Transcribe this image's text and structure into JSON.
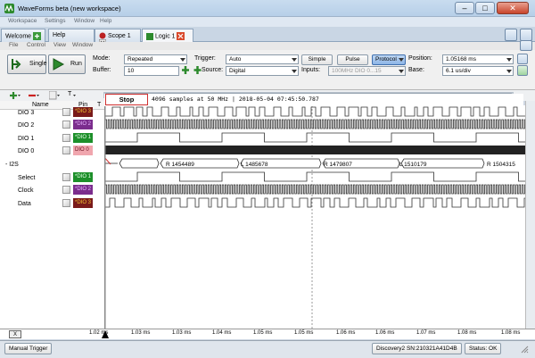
{
  "window": {
    "title": "WaveForms beta (new workspace)",
    "controls": {
      "minimize": "–",
      "maximize": "□",
      "close": "✕"
    }
  },
  "menu": [
    "Workspace",
    "Settings",
    "Window",
    "Help"
  ],
  "tabs": [
    {
      "label": "Welcome",
      "active": false
    },
    {
      "label": "Help",
      "active": false
    },
    {
      "label": "Scope 1",
      "active": false
    },
    {
      "label": "Logic 1",
      "active": true
    }
  ],
  "submenu": [
    "File",
    "Control",
    "View",
    "Window"
  ],
  "controls": {
    "single_label": "Single",
    "run_label": "Run",
    "mode_label": "Mode:",
    "mode_value": "Repeated",
    "buffer_label": "Buffer:",
    "buffer_value": "10",
    "trigger_label": "Trigger:",
    "trigger_value": "Auto",
    "source_label": "Source:",
    "source_value": "Digital",
    "simple_label": "Simple",
    "pulse_label": "Pulse",
    "protocol_label": "Protocol",
    "inputs_label": "Inputs:",
    "inputs_value": "100MHz DIO 0...15",
    "position_label": "Position:",
    "position_value": "1.05168 ms",
    "base_label": "Base:",
    "base_value": "6.1 us/div"
  },
  "toolbar": {
    "add": "+",
    "remove": "−",
    "t_label": "T"
  },
  "channel_header": {
    "name": "Name",
    "pin": "Pin",
    "t": "T"
  },
  "status": {
    "stop_label": "Stop",
    "info": "4096 samples at 50 MHz | 2018-05-04 07:45:50.787"
  },
  "channels": [
    {
      "name": "DIO 3",
      "pin": "*DIO 3",
      "color": "c3"
    },
    {
      "name": "DIO 2",
      "pin": "*DIO 2",
      "color": "c2"
    },
    {
      "name": "DIO 1",
      "pin": "*DIO 1",
      "color": "c1"
    },
    {
      "name": "DIO 0",
      "pin": "DIO 0",
      "color": "c0"
    },
    {
      "name": "- I2S",
      "pin": "",
      "color": ""
    },
    {
      "name": "Select",
      "pin": "*DIO 1",
      "color": "c1"
    },
    {
      "name": "Clock",
      "pin": "*DIO 2",
      "color": "c2"
    },
    {
      "name": "Data",
      "pin": "*DIO 3",
      "color": "c3"
    }
  ],
  "i2s_labels": [
    "R 1454489",
    "L 1485678",
    "R 1479807",
    "L 1510179",
    "R 1504315"
  ],
  "axis": {
    "x_button": "X",
    "ticks": [
      "1.02 ms",
      "1.03 ms",
      "1.03 ms",
      "1.04 ms",
      "1.05 ms",
      "1.05 ms",
      "1.06 ms",
      "1.06 ms",
      "1.07 ms",
      "1.08 ms",
      "1.08 ms"
    ]
  },
  "statusbar": {
    "manual_trigger": "Manual Trigger",
    "device": "Discovery2 SN:210321A41D4B",
    "status": "Status: OK"
  },
  "colors": {
    "dio3": "#7a1a1a",
    "dio2": "#7b2d8d",
    "dio1": "#1d8f2a",
    "dio0": "#f0a6ae",
    "stop_border": "#d03030",
    "accent": "#3f6fae"
  }
}
